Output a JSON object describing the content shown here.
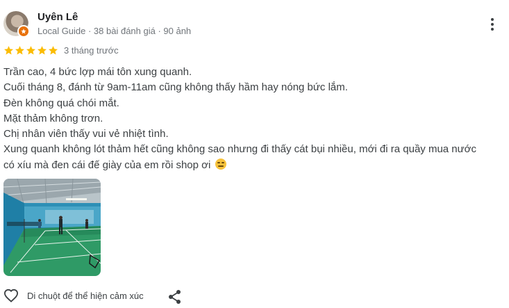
{
  "reviewer": {
    "name": "Uyên Lê",
    "meta": "Local Guide · 38 bài đánh giá · 90 ảnh"
  },
  "review": {
    "stars": 5,
    "date": "3 tháng trước",
    "lines": [
      "Trần cao, 4 bức lợp mái tôn xung quanh.",
      "Cuối tháng 8, đánh từ 9am-11am cũng không thấy hầm hay nóng bức lắm.",
      "Đèn không quá chói mắt.",
      "Mặt thảm không trơn.",
      "Chị nhân viên thấy vui vẻ nhiệt tình.",
      "Xung quanh không lót thảm hết cũng không sao nhưng đi thấy cát bụi nhiều, mới đi ra quầy mua nước",
      "có xíu mà đen cái đế giày của em rồi shop ơi"
    ]
  },
  "footer": {
    "like_label": "Di chuột để thể hiện cảm xúc"
  },
  "colors": {
    "star": "#fbbc04",
    "secondary_text": "#70757a",
    "body_text": "#3c4043",
    "badge": "#e8710a"
  },
  "icons": {
    "star": "star-icon",
    "more": "more-vert-icon",
    "like": "heart-outline-icon",
    "share": "share-icon",
    "emoji": "expressionless-face-emoji"
  }
}
